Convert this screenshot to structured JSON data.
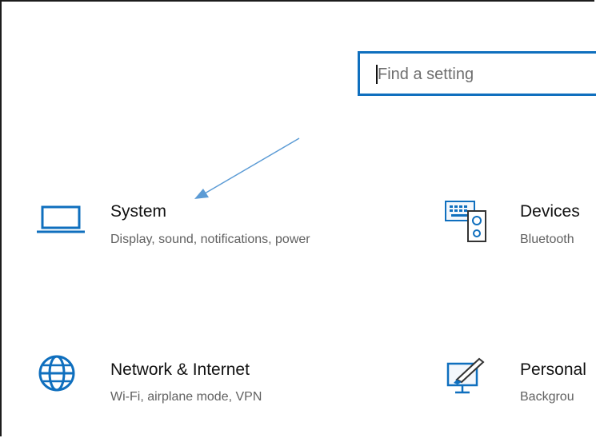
{
  "search": {
    "placeholder": "Find a setting",
    "value": ""
  },
  "tiles": [
    {
      "title": "System",
      "description": "Display, sound, notifications, power",
      "icon": "laptop-icon"
    },
    {
      "title": "Devices",
      "description": "Bluetooth",
      "icon": "devices-icon"
    },
    {
      "title": "Network & Internet",
      "description": "Wi-Fi, airplane mode, VPN",
      "icon": "globe-icon"
    },
    {
      "title": "Personal",
      "description": "Backgrou",
      "icon": "personalization-icon"
    }
  ],
  "colors": {
    "accent": "#0f6fbe",
    "arrow": "#5b9bd5",
    "title": "#111111",
    "description": "#616161"
  },
  "annotation": {
    "type": "arrow",
    "points_to": "System"
  }
}
